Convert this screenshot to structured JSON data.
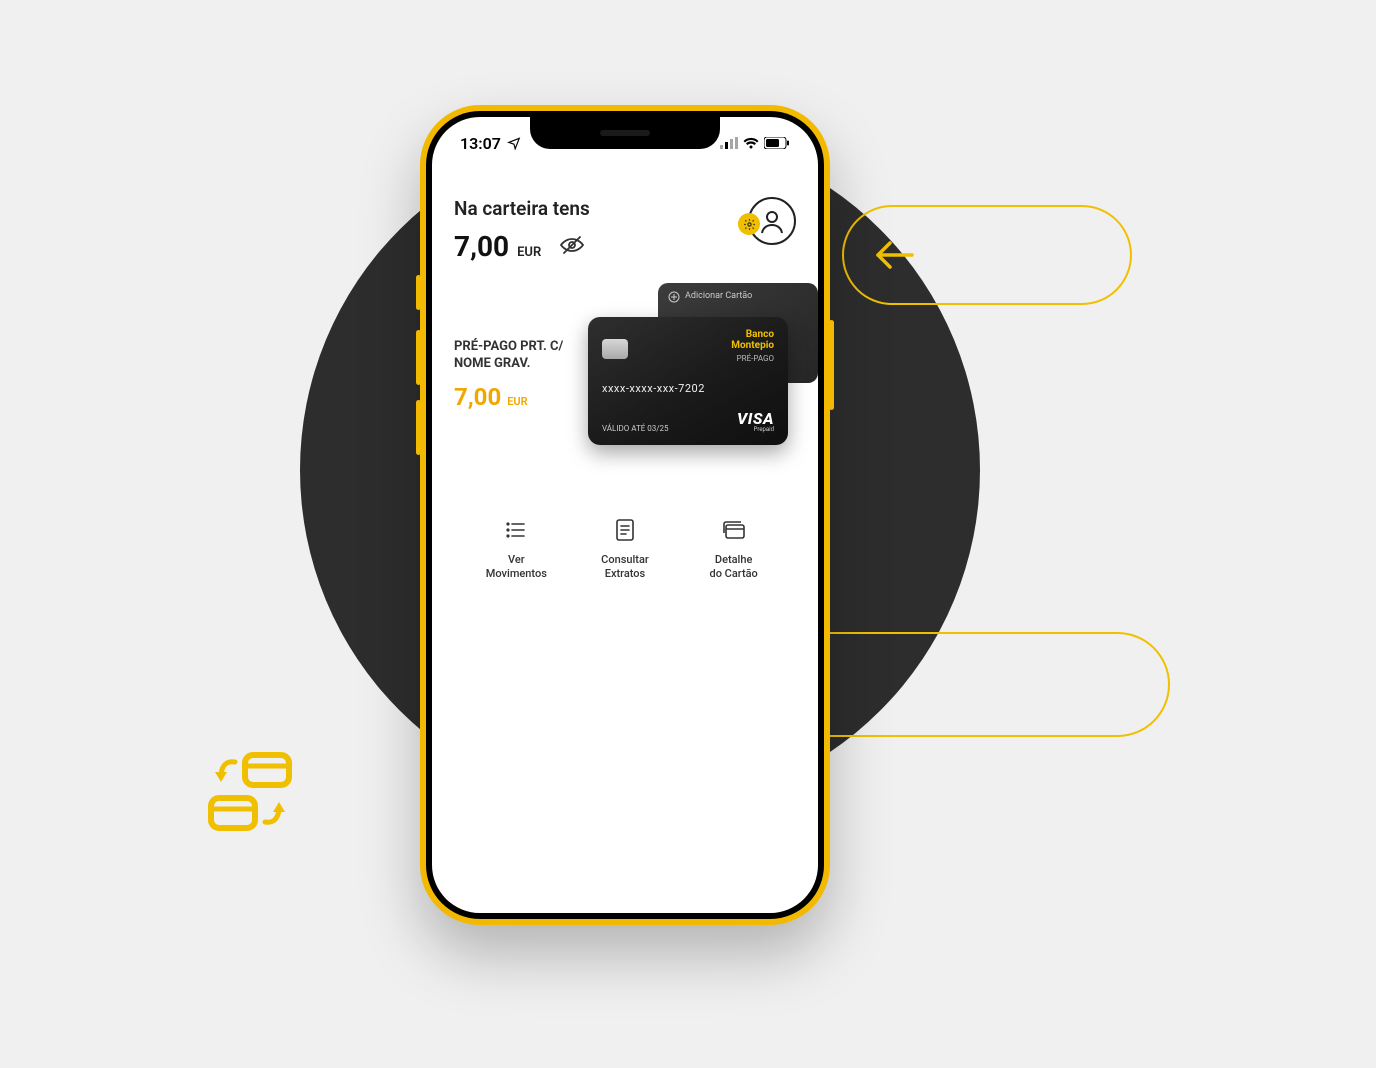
{
  "status": {
    "time": "13:07"
  },
  "header": {
    "wallet_label": "Na carteira tens",
    "balance": "7,00",
    "currency": "EUR"
  },
  "card": {
    "name_line1": "PRÉ-PAGO PRT. C/",
    "name_line2": "NOME GRAV.",
    "balance": "7,00",
    "currency": "EUR",
    "add_label": "Adicionar Cartão",
    "brand_line1": "Banco",
    "brand_line2": "Montepio",
    "type": "PRÉ-PAGO",
    "number": "xxxx-xxxx-xxx-7202",
    "valid_label": "VÁLIDO ATÉ 03/25",
    "network": "VISA",
    "network_sub": "Prepaid"
  },
  "actions": [
    {
      "line1": "Ver",
      "line2": "Movimentos"
    },
    {
      "line1": "Consultar",
      "line2": "Extratos"
    },
    {
      "line1": "Detalhe",
      "line2": "do Cartão"
    }
  ]
}
